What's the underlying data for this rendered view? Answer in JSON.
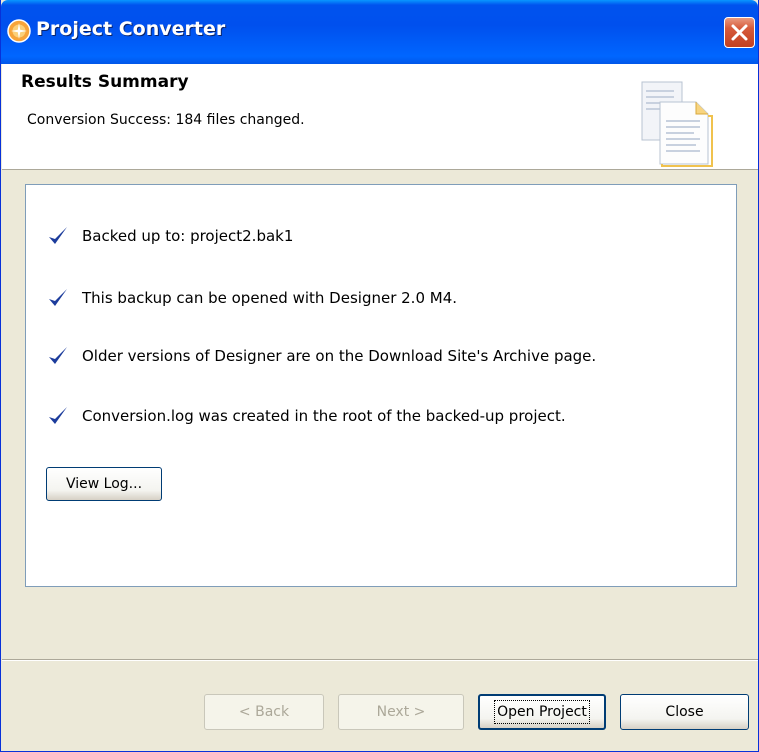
{
  "window": {
    "title": "Project Converter",
    "title_icon": "project-converter-icon",
    "close_icon": "close-icon"
  },
  "header": {
    "title": "Results Summary",
    "message": "Conversion Success: 184 files changed.",
    "icon": "documents-icon"
  },
  "results": {
    "items": [
      {
        "text": "Backed up to:  project2.bak1",
        "icon": "checkmark-icon"
      },
      {
        "text": "This backup can be opened with Designer 2.0 M4.",
        "icon": "checkmark-icon"
      },
      {
        "text": "Older versions of Designer are on the Download Site's Archive page.",
        "icon": "checkmark-icon"
      },
      {
        "text": "Conversion.log was created in the root of the backed-up project.",
        "icon": "checkmark-icon"
      }
    ],
    "view_log_label": "View Log..."
  },
  "buttons": {
    "back_label": "< Back",
    "next_label": "Next >",
    "open_project_label": "Open Project",
    "close_label": "Close"
  },
  "colors": {
    "titlebar": "#0053ee",
    "check": "#1c3c9c",
    "dialog_bg": "#ece9d8"
  }
}
